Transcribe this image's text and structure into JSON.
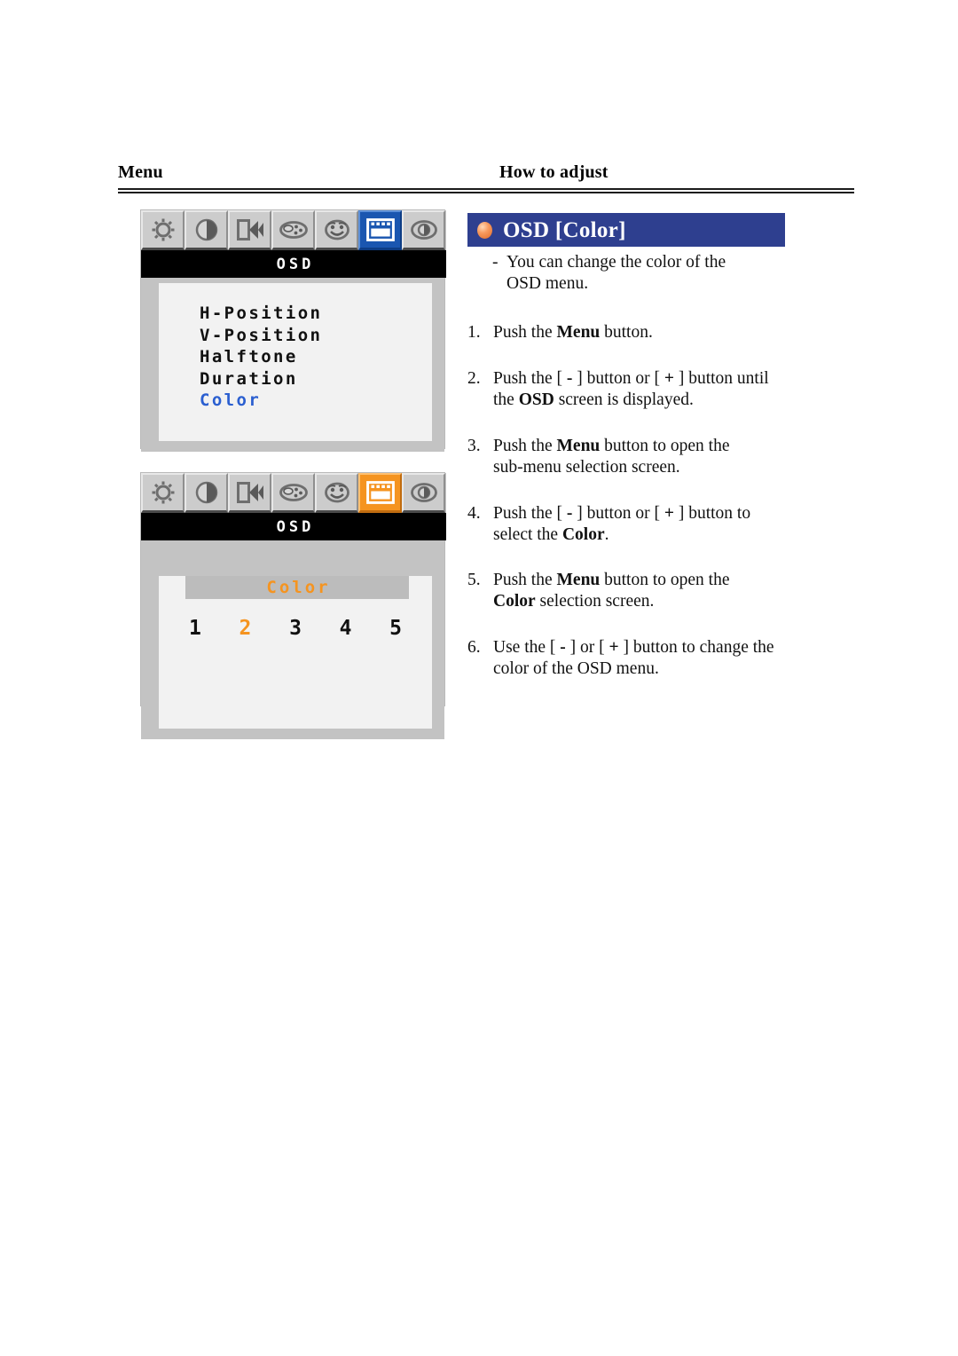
{
  "header": {
    "left_title": "Menu",
    "right_title": "How to adjust"
  },
  "osd_panel_1": {
    "icons": [
      {
        "name": "brightness-gear-icon",
        "selected": false
      },
      {
        "name": "contrast-icon",
        "selected": false
      },
      {
        "name": "rewind-geometry-icon",
        "selected": false
      },
      {
        "name": "color-palette-icon",
        "selected": false
      },
      {
        "name": "face-misc-icon",
        "selected": false
      },
      {
        "name": "osd-menu-icon",
        "selected": true
      },
      {
        "name": "tracking-phase-icon",
        "selected": false
      }
    ],
    "title": "OSD",
    "menu_items": [
      {
        "label": "H-Position",
        "selected": false
      },
      {
        "label": "V-Position",
        "selected": false
      },
      {
        "label": "Halftone",
        "selected": false
      },
      {
        "label": "Duration",
        "selected": false
      },
      {
        "label": "Color",
        "selected": true
      }
    ],
    "selected_color": "#2b5fd0"
  },
  "osd_panel_2": {
    "icons": [
      {
        "name": "brightness-gear-icon",
        "selected": false
      },
      {
        "name": "contrast-icon",
        "selected": false
      },
      {
        "name": "rewind-geometry-icon",
        "selected": false
      },
      {
        "name": "color-palette-icon",
        "selected": false
      },
      {
        "name": "face-misc-icon",
        "selected": false
      },
      {
        "name": "osd-menu-icon",
        "selected": true
      },
      {
        "name": "tracking-phase-icon",
        "selected": false
      }
    ],
    "title": "OSD",
    "banner_label": "Color",
    "options": [
      "1",
      "2",
      "3",
      "4",
      "5"
    ],
    "selected_option": "2",
    "highlight_color": "#f59420"
  },
  "instructions": {
    "heading": "OSD [Color]",
    "heading_bg": "#2e3f8f",
    "bullet_icon": "orange-sphere-bullet-icon",
    "intro_line_1": "You can change the color of the",
    "intro_line_2": "OSD menu.",
    "steps": [
      {
        "num": "1.",
        "parts": [
          {
            "t": "Push the ",
            "b": false
          },
          {
            "t": "Menu",
            "b": true
          },
          {
            "t": " button.",
            "b": false
          }
        ]
      },
      {
        "num": "2.",
        "parts": [
          {
            "t": "Push the [ ",
            "b": false
          },
          {
            "t": "-",
            "b": true
          },
          {
            "t": " ]  button or [ ",
            "b": false
          },
          {
            "t": "+",
            "b": true
          },
          {
            "t": " ]  button until",
            "b": false
          },
          {
            "t": "\n",
            "b": false
          },
          {
            "t": "the ",
            "b": false
          },
          {
            "t": "OSD",
            "b": true
          },
          {
            "t": " screen is displayed.",
            "b": false
          }
        ]
      },
      {
        "num": "3.",
        "parts": [
          {
            "t": "Push the ",
            "b": false
          },
          {
            "t": "Menu",
            "b": true
          },
          {
            "t": " button to open the",
            "b": false
          },
          {
            "t": "\n",
            "b": false
          },
          {
            "t": "sub-menu selection screen.",
            "b": false
          }
        ]
      },
      {
        "num": "4.",
        "parts": [
          {
            "t": "Push the [ ",
            "b": false
          },
          {
            "t": "-",
            "b": true
          },
          {
            "t": " ]  button or [ ",
            "b": false
          },
          {
            "t": "+",
            "b": true
          },
          {
            "t": " ] button to",
            "b": false
          },
          {
            "t": "\n",
            "b": false
          },
          {
            "t": "select the ",
            "b": false
          },
          {
            "t": "Color",
            "b": true
          },
          {
            "t": ".",
            "b": false
          }
        ]
      },
      {
        "num": "5.",
        "parts": [
          {
            "t": "Push the ",
            "b": false
          },
          {
            "t": "Menu",
            "b": true
          },
          {
            "t": " button to open the",
            "b": false
          },
          {
            "t": "\n",
            "b": false
          },
          {
            "t": "Color",
            "b": true
          },
          {
            "t": " selection screen.",
            "b": false
          }
        ]
      },
      {
        "num": "6.",
        "parts": [
          {
            "t": "Use the [ ",
            "b": false
          },
          {
            "t": "-",
            "b": true
          },
          {
            "t": " ] or [ ",
            "b": false
          },
          {
            "t": "+",
            "b": true
          },
          {
            "t": " ] button to change the",
            "b": false
          },
          {
            "t": "\n",
            "b": false
          },
          {
            "t": "color of the OSD menu.",
            "b": false
          }
        ]
      }
    ]
  }
}
